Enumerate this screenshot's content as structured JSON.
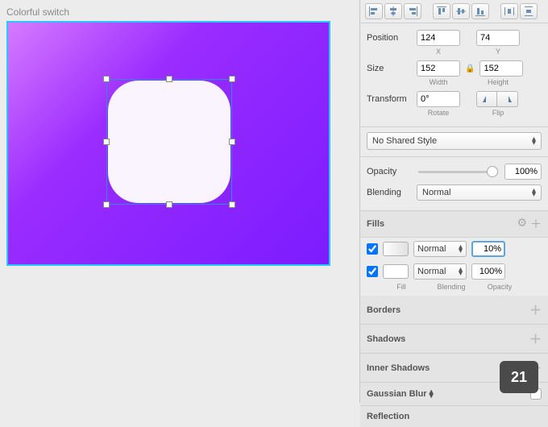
{
  "artboard": {
    "title": "Colorful switch"
  },
  "inspector": {
    "position": {
      "label": "Position",
      "x": "124",
      "y": "74",
      "xlabel": "X",
      "ylabel": "Y"
    },
    "size": {
      "label": "Size",
      "w": "152",
      "h": "152",
      "wlabel": "Width",
      "hlabel": "Height"
    },
    "transform": {
      "label": "Transform",
      "rotate": "0°",
      "rotlabel": "Rotate",
      "fliplabel": "Flip"
    },
    "style": {
      "selected": "No Shared Style"
    },
    "opacity": {
      "label": "Opacity",
      "value": "100%"
    },
    "blending": {
      "label": "Blending",
      "value": "Normal"
    },
    "fills": {
      "title": "Fills",
      "rows": [
        {
          "checked": true,
          "blend": "Normal",
          "opacity": "10%"
        },
        {
          "checked": true,
          "blend": "Normal",
          "opacity": "100%"
        }
      ],
      "sublabels": {
        "fill": "Fill",
        "blend": "Blending",
        "op": "Opacity"
      }
    },
    "panels": {
      "borders": "Borders",
      "shadows": "Shadows",
      "inner": "Inner Shadows",
      "gblur": "Gaussian Blur",
      "reflection": "Reflection"
    }
  },
  "badge": "21"
}
